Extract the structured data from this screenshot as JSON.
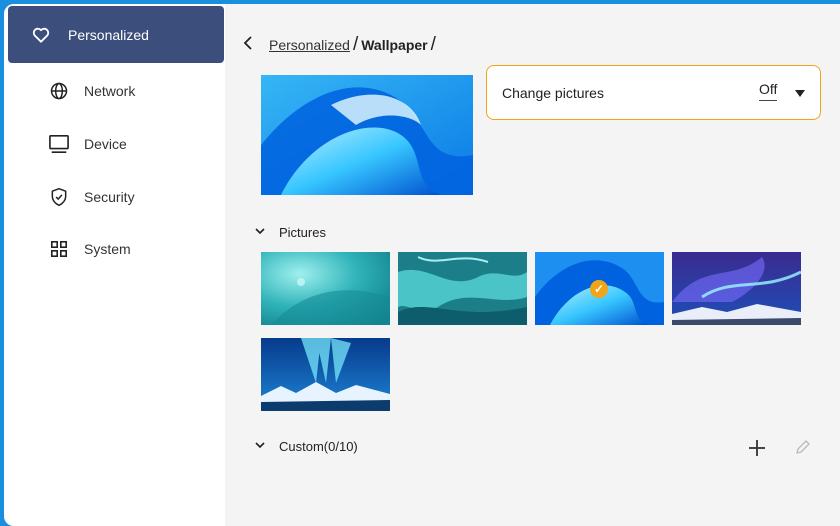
{
  "sidebar": {
    "items": [
      {
        "label": "Personalized",
        "icon": "heart-icon",
        "active": true
      },
      {
        "label": "Network",
        "icon": "globe-icon"
      },
      {
        "label": "Device",
        "icon": "monitor-icon"
      },
      {
        "label": "Security",
        "icon": "shield-check-icon"
      },
      {
        "label": "System",
        "icon": "grid-icon"
      }
    ]
  },
  "breadcrumb": {
    "back_icon": "chevron-left-icon",
    "parent": "Personalized",
    "separator": "/",
    "current": "Wallpaper"
  },
  "change_pictures": {
    "label": "Change pictures",
    "value": "Off",
    "icon": "caret-down-icon"
  },
  "pictures_section": {
    "label": "Pictures",
    "icon": "chevron-down-icon"
  },
  "custom_section": {
    "label": "Custom(0/10)",
    "icon": "chevron-down-icon",
    "add_icon": "plus-icon",
    "edit_icon": "pencil-icon"
  },
  "thumbnails": [
    {
      "name": "teal-water",
      "selected": false
    },
    {
      "name": "marble",
      "selected": false
    },
    {
      "name": "blue-swirl",
      "selected": true
    },
    {
      "name": "aurora-purple",
      "selected": false
    },
    {
      "name": "aurora-mountains",
      "selected": false
    }
  ],
  "colors": {
    "accent": "#f0a516",
    "sidebar_active": "#3b4e7c",
    "screen_border": "#1a8fe0",
    "content_bg": "#f4f4f4"
  }
}
